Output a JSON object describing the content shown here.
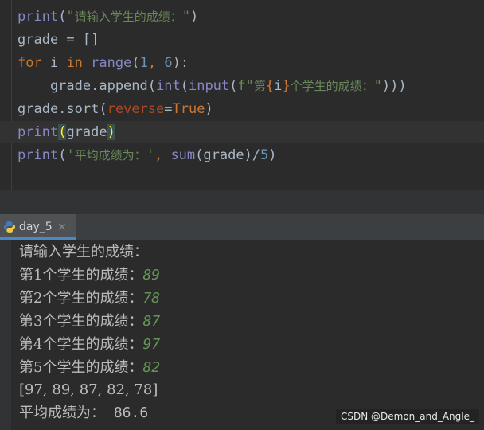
{
  "editor": {
    "lines": [
      {
        "tokens": [
          {
            "t": "print",
            "c": "bi"
          },
          {
            "t": "(",
            "c": "plain"
          },
          {
            "t": "\"",
            "c": "str"
          },
          {
            "t": "请输入学生的成绩：",
            "c": "str cjk"
          },
          {
            "t": "\"",
            "c": "str"
          },
          {
            "t": ")",
            "c": "plain"
          }
        ]
      },
      {
        "tokens": [
          {
            "t": "grade = []",
            "c": "plain"
          }
        ]
      },
      {
        "tokens": [
          {
            "t": "for",
            "c": "kw"
          },
          {
            "t": " i ",
            "c": "plain"
          },
          {
            "t": "in",
            "c": "kw"
          },
          {
            "t": " ",
            "c": "plain"
          },
          {
            "t": "range",
            "c": "bi"
          },
          {
            "t": "(",
            "c": "plain"
          },
          {
            "t": "1",
            "c": "num"
          },
          {
            "t": ", ",
            "c": "kw"
          },
          {
            "t": "6",
            "c": "num"
          },
          {
            "t": "):",
            "c": "plain"
          }
        ]
      },
      {
        "tokens": [
          {
            "t": "    grade.append(",
            "c": "plain"
          },
          {
            "t": "int",
            "c": "bi"
          },
          {
            "t": "(",
            "c": "plain"
          },
          {
            "t": "input",
            "c": "bi"
          },
          {
            "t": "(",
            "c": "plain"
          },
          {
            "t": "f\"",
            "c": "str"
          },
          {
            "t": "第",
            "c": "str cjk"
          },
          {
            "t": "{",
            "c": "kw"
          },
          {
            "t": "i",
            "c": "plain"
          },
          {
            "t": "}",
            "c": "kw"
          },
          {
            "t": "个学生的成绩：",
            "c": "str cjk"
          },
          {
            "t": "\"",
            "c": "str"
          },
          {
            "t": ")))",
            "c": "plain"
          }
        ]
      },
      {
        "tokens": [
          {
            "t": "grade.sort(",
            "c": "plain"
          },
          {
            "t": "reverse",
            "c": "param"
          },
          {
            "t": "=",
            "c": "plain"
          },
          {
            "t": "True",
            "c": "kw"
          },
          {
            "t": ")",
            "c": "plain"
          }
        ]
      },
      {
        "current": true,
        "tokens": [
          {
            "t": "print",
            "c": "bi"
          },
          {
            "t": "(",
            "c": "brace-hl"
          },
          {
            "t": "grade",
            "c": "plain"
          },
          {
            "t": ")",
            "c": "brace-hl"
          }
        ]
      },
      {
        "tokens": [
          {
            "t": "print",
            "c": "bi"
          },
          {
            "t": "(",
            "c": "plain"
          },
          {
            "t": "'",
            "c": "str"
          },
          {
            "t": "平均成绩为：",
            "c": "str cjk"
          },
          {
            "t": "'",
            "c": "str"
          },
          {
            "t": ", ",
            "c": "kw"
          },
          {
            "t": "sum",
            "c": "bi"
          },
          {
            "t": "(grade)/",
            "c": "plain"
          },
          {
            "t": "5",
            "c": "num"
          },
          {
            "t": ")",
            "c": "plain"
          }
        ]
      }
    ]
  },
  "run_tab": {
    "label": "day_5",
    "close": "×",
    "icon": "python-icon"
  },
  "console": {
    "prompt_header": "请输入学生的成绩：",
    "entries": [
      {
        "prompt": "第1个学生的成绩：",
        "input": "89"
      },
      {
        "prompt": "第2个学生的成绩：",
        "input": "78"
      },
      {
        "prompt": "第3个学生的成绩：",
        "input": "87"
      },
      {
        "prompt": "第4个学生的成绩：",
        "input": "97"
      },
      {
        "prompt": "第5个学生的成绩：",
        "input": "82"
      }
    ],
    "sorted_list": "[97, 89, 87, 82, 78]",
    "average_label": "平均成绩为：",
    "average_value": " 86.6"
  },
  "watermark": "CSDN @Demon_and_Angle_"
}
